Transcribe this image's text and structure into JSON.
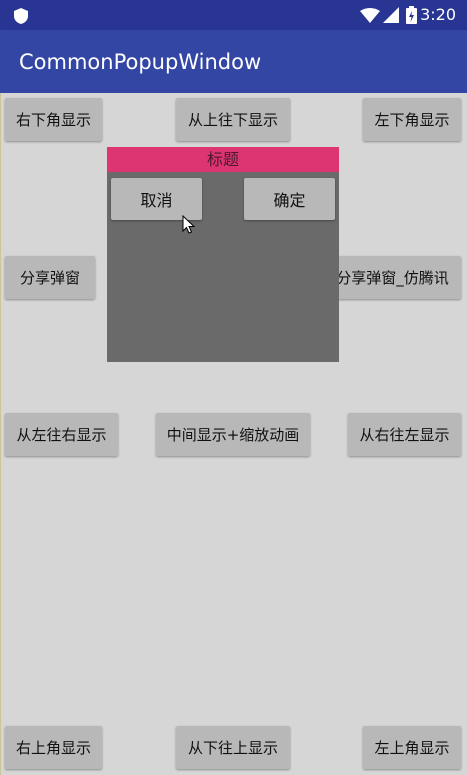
{
  "status_bar": {
    "time": "3:20"
  },
  "app": {
    "title": "CommonPopupWindow"
  },
  "buttons": {
    "bottom_right": "右下角显示",
    "top_to_bottom": "从上往下显示",
    "bottom_left": "左下角显示",
    "share_popup": "分享弹窗",
    "share_popup_tencent": "分享弹窗_仿腾讯",
    "left_to_right": "从左往右显示",
    "center_scale": "中间显示+缩放动画",
    "right_to_left": "从右往左显示",
    "top_right": "右上角显示",
    "bottom_to_top": "从下往上显示",
    "top_left": "左上角显示"
  },
  "popup": {
    "title": "标题",
    "cancel": "取消",
    "confirm": "确定"
  },
  "colors": {
    "status_bar": "#283593",
    "app_bar": "#3346a3",
    "popup_title_bg": "#dd3472",
    "popup_body_bg": "#6a6a6a"
  }
}
